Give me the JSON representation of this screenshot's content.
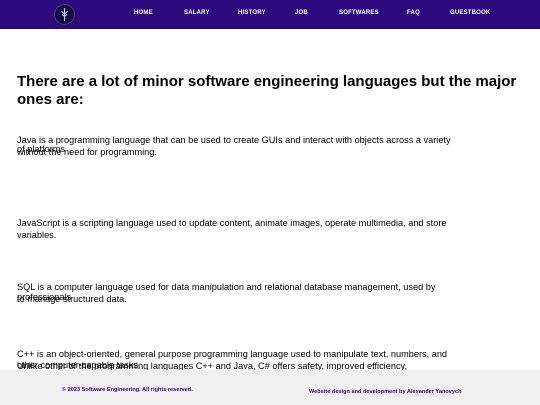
{
  "nav": {
    "items": [
      "HOME",
      "SALARY",
      "HISTORY",
      "JOB",
      "SOFTWARES",
      "FAQ",
      "GUESTBOOK"
    ]
  },
  "main": {
    "heading_line1": "There are a lot of minor software engineering languages but the major",
    "heading_line2": "ones are:",
    "paragraphs": [
      {
        "line1": "Java is a programming language that can be used to create GUIs and interact with objects across a variety",
        "line2": "without the need for programming.",
        "overlay": "of platforms"
      },
      {
        "line1": "JavaScript is a scripting language used to update content, animate images, operate multimedia, and store",
        "line2": "variables."
      },
      {
        "line1": "SQL is a computer language used for data manipulation and relational database management, used by",
        "line2": "to manage structured data.",
        "overlay": "professionals"
      },
      {
        "line1": "C++ is an object-oriented, general purpose programming language used to manipulate text, numbers, and",
        "line2": "Unlike other of the programming languages C++ and Java, C# offers safety, improved efficiency,",
        "overlay": "other computer-capable tasks."
      }
    ]
  },
  "footer": {
    "copyright": "© 2023 Software Engineering. All rights reserved.",
    "credit": "Website design and development by Alexander Yanovych"
  }
}
